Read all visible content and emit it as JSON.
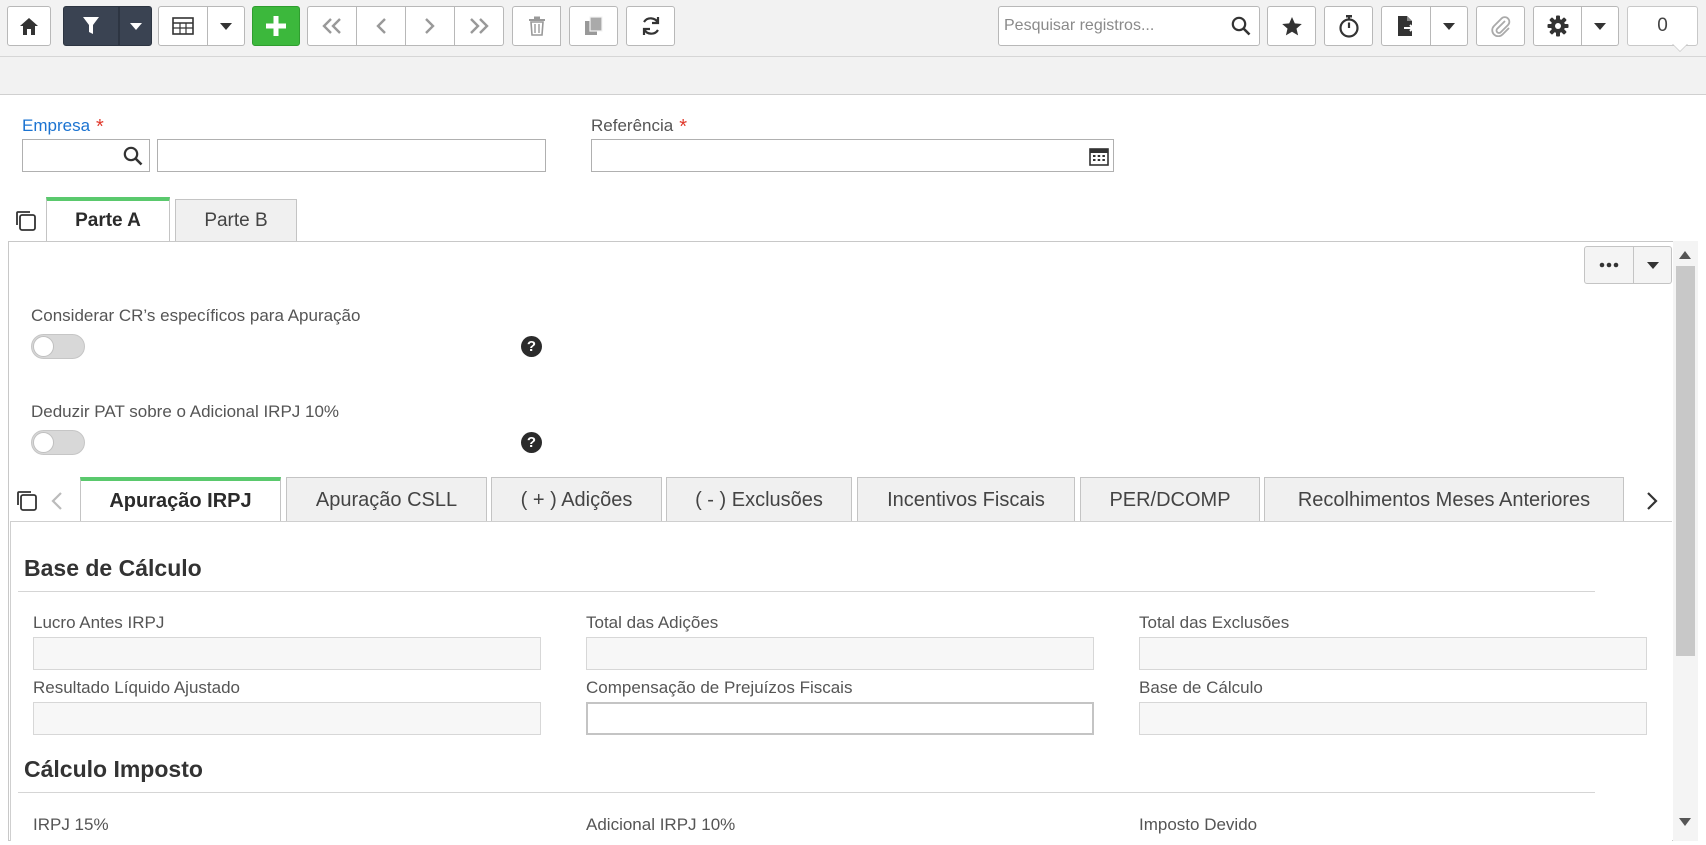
{
  "toolbar": {
    "search_placeholder": "Pesquisar registros...",
    "record_count": "0"
  },
  "header": {
    "empresa_label": "Empresa",
    "referencia_label": "Referência",
    "required_mark": "*",
    "empresa_code": "",
    "empresa_name": "",
    "referencia_value": ""
  },
  "top_tabs": [
    {
      "label": "Parte A",
      "active": true
    },
    {
      "label": "Parte B",
      "active": false
    }
  ],
  "options": {
    "considerar_label": "Considerar CR’s específicos para Apuração",
    "considerar_on": false,
    "deduzir_label": "Deduzir PAT sobre o Adicional IRPJ 10%",
    "deduzir_on": false,
    "help_glyph": "?"
  },
  "sub_tabs": [
    {
      "label": "Apuração IRPJ",
      "active": true
    },
    {
      "label": "Apuração CSLL",
      "active": false
    },
    {
      "label": "( + ) Adições",
      "active": false
    },
    {
      "label": "( - ) Exclusões",
      "active": false
    },
    {
      "label": "Incentivos Fiscais",
      "active": false
    },
    {
      "label": "PER/DCOMP",
      "active": false
    },
    {
      "label": "Recolhimentos Meses Anteriores",
      "active": false
    }
  ],
  "base_calculo": {
    "title": "Base de Cálculo",
    "fields": {
      "lucro_antes_irpj": "Lucro Antes IRPJ",
      "total_adicoes": "Total das Adições",
      "total_exclusoes": "Total das Exclusões",
      "resultado_liquido": "Resultado Líquido Ajustado",
      "compensacao_prejuizos": "Compensação de Prejuízos Fiscais",
      "base_calculo": "Base de Cálculo"
    }
  },
  "calculo_imposto": {
    "title": "Cálculo Imposto",
    "fields": {
      "irpj_15": "IRPJ 15%",
      "adicional_irpj_10": "Adicional IRPJ 10%",
      "imposto_devido": "Imposto Devido"
    }
  },
  "colors": {
    "accent_green": "#5ac96d",
    "label_blue": "#1b73d1",
    "required_red": "#e0382b",
    "toolbar_dark": "#3a4352",
    "add_green": "#3cb83c"
  }
}
